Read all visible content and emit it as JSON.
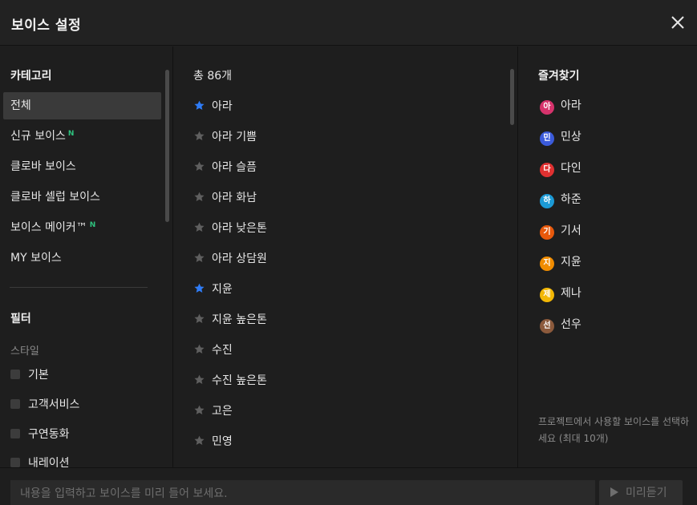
{
  "dialog": {
    "title": "보이스 설정"
  },
  "categories": {
    "title": "카테고리",
    "items": [
      {
        "label": "전체",
        "badge": ""
      },
      {
        "label": "신규 보이스",
        "badge": "N"
      },
      {
        "label": "클로바 보이스",
        "badge": ""
      },
      {
        "label": "클로바 셀럽 보이스",
        "badge": ""
      },
      {
        "label": "보이스 메이커™",
        "badge": "N"
      },
      {
        "label": "MY 보이스",
        "badge": ""
      }
    ],
    "selected": "전체"
  },
  "filter": {
    "title": "필터",
    "style_label": "스타일",
    "options": [
      "기본",
      "고객서비스",
      "구연동화",
      "내레이션"
    ]
  },
  "voices": {
    "total_label": "총 86개",
    "items": [
      {
        "name": "아라",
        "favorite": true
      },
      {
        "name": "아라 기쁨",
        "favorite": false
      },
      {
        "name": "아라 슬픔",
        "favorite": false
      },
      {
        "name": "아라 화남",
        "favorite": false
      },
      {
        "name": "아라 낮은톤",
        "favorite": false
      },
      {
        "name": "아라 상담원",
        "favorite": false
      },
      {
        "name": "지윤",
        "favorite": true
      },
      {
        "name": "지윤 높은톤",
        "favorite": false
      },
      {
        "name": "수진",
        "favorite": false
      },
      {
        "name": "수진 높은톤",
        "favorite": false
      },
      {
        "name": "고은",
        "favorite": false
      },
      {
        "name": "민영",
        "favorite": false
      }
    ]
  },
  "favorites": {
    "title": "즐겨찾기",
    "items": [
      {
        "initial": "아",
        "name": "아라",
        "color": "#d6336c"
      },
      {
        "initial": "민",
        "name": "민상",
        "color": "#3b5bdb"
      },
      {
        "initial": "다",
        "name": "다인",
        "color": "#e03131"
      },
      {
        "initial": "하",
        "name": "하준",
        "color": "#1c9ad6"
      },
      {
        "initial": "기",
        "name": "기서",
        "color": "#e8590c"
      },
      {
        "initial": "지",
        "name": "지윤",
        "color": "#f08c00"
      },
      {
        "initial": "제",
        "name": "제나",
        "color": "#f2b705"
      },
      {
        "initial": "선",
        "name": "선우",
        "color": "#8c5a3c"
      }
    ],
    "hint": "프로젝트에서 사용할 보이스를 선택하세요 (최대 10개)"
  },
  "footer": {
    "input_placeholder": "내용을 입력하고 보이스를 미리 들어 보세요.",
    "preview_label": "미리듣기"
  },
  "colors": {
    "background": "#1e1e1e",
    "star_active": "#2f7cf6",
    "star_inactive": "#5f5f5f",
    "new_badge": "#2ec27e"
  }
}
